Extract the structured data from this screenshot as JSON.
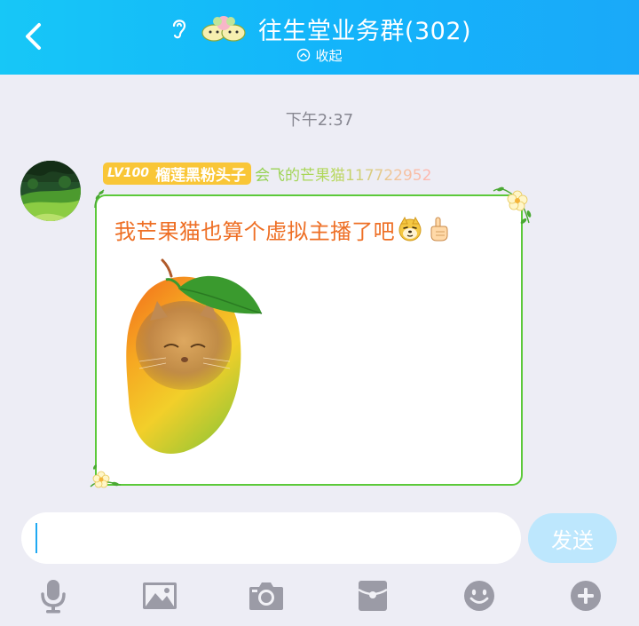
{
  "header": {
    "title": "往生堂业务群(302)",
    "collapse_label": "收起",
    "icons": [
      "back-icon",
      "ear-icon",
      "group-emoji-icon",
      "chevron-up-circle-icon"
    ]
  },
  "chat": {
    "timestamp": "下午2:37",
    "message": {
      "level": "LV100",
      "member_title": "榴莲黑粉头子",
      "sender": "会飞的芒果猫117722952",
      "text": "我芒果猫也算个虚拟主播了吧",
      "emojis": [
        "doge-face-emoji",
        "pointing-up-hand-emoji"
      ],
      "image": "mango-cat-sticker"
    }
  },
  "input": {
    "value": "",
    "send_label": "发送"
  },
  "toolbar": {
    "items": [
      "microphone-icon",
      "image-icon",
      "camera-icon",
      "red-packet-icon",
      "smiley-icon",
      "plus-icon"
    ]
  },
  "colors": {
    "header_start": "#17c7f7",
    "header_end": "#1aa9f9",
    "bubble_border": "#5cc93a",
    "message_text": "#ee6f25",
    "level_badge": "#f9c637",
    "send_button": "#bde7fd",
    "caret": "#1fa9f2"
  }
}
